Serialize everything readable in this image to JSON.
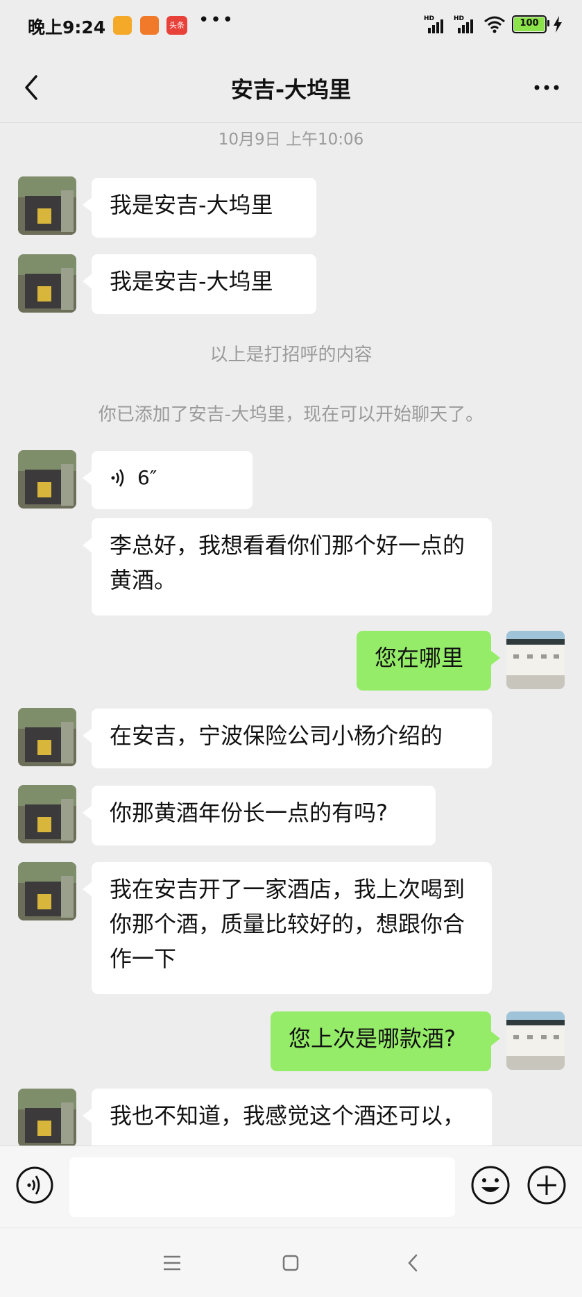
{
  "status_bar": {
    "time": "晚上9:24",
    "apps": [
      "notes-app-icon",
      "shopping-app-icon",
      "toutiao-app-icon"
    ],
    "toutiao_label": "头条",
    "overflow": "•••",
    "network": [
      "HD",
      "HD"
    ],
    "battery": "100"
  },
  "header": {
    "title": "安吉-大坞里",
    "back_icon": "chevron-left-icon",
    "more_icon": "more-dots-icon"
  },
  "chat": {
    "timestamp": "10月9日 上午10:06",
    "greeting_note": "以上是打招呼的内容",
    "added_note": "你已添加了安吉-大坞里，现在可以开始聊天了。",
    "messages": [
      {
        "from": "them",
        "text": "我是安吉-大坞里"
      },
      {
        "from": "them",
        "text": "我是安吉-大坞里"
      },
      {
        "from": "them",
        "type": "voice",
        "duration": "6″"
      },
      {
        "from": "them",
        "text": "李总好，我想看看你们那个好一点的黄酒。"
      },
      {
        "from": "me",
        "text": "您在哪里"
      },
      {
        "from": "them",
        "text": "在安吉，宁波保险公司小杨介绍的"
      },
      {
        "from": "them",
        "text": "你那黄酒年份长一点的有吗?"
      },
      {
        "from": "them",
        "text": "我在安吉开了一家酒店，我上次喝到你那个酒，质量比较好的，想跟你合作一下"
      },
      {
        "from": "me",
        "text": "您上次是哪款酒?"
      },
      {
        "from": "them",
        "text": "我也不知道，我感觉这个酒还可以，"
      }
    ]
  },
  "input_bar": {
    "voice_icon": "voice-input-icon",
    "placeholder": "",
    "emoji_icon": "emoji-icon",
    "plus_icon": "plus-icon"
  },
  "system_nav": {
    "menu_icon": "menu-icon",
    "home_icon": "home-icon",
    "back_icon": "back-icon"
  },
  "colors": {
    "background": "#ededed",
    "incoming_bubble": "#ffffff",
    "outgoing_bubble": "#95ec69"
  }
}
